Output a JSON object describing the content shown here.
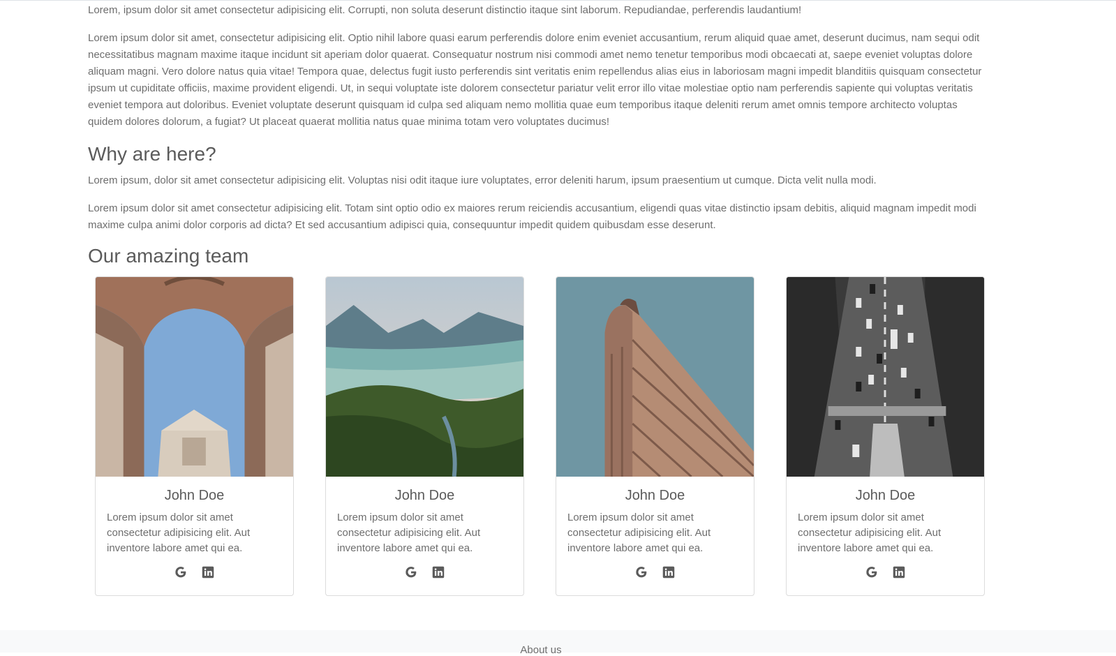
{
  "content": {
    "paragraphs_intro": [
      "Lorem, ipsum dolor sit amet consectetur adipisicing elit. Corrupti, non soluta deserunt distinctio itaque sint laborum. Repudiandae, perferendis laudantium!",
      "Lorem ipsum dolor sit amet, consectetur adipisicing elit. Optio nihil labore quasi earum perferendis dolore enim eveniet accusantium, rerum aliquid quae amet, deserunt ducimus, nam sequi odit necessitatibus magnam maxime itaque incidunt sit aperiam dolor quaerat. Consequatur nostrum nisi commodi amet nemo tenetur temporibus modi obcaecati at, saepe eveniet voluptas dolore aliquam magni. Vero dolore natus quia vitae! Tempora quae, delectus fugit iusto perferendis sint veritatis enim repellendus alias eius in laboriosam magni impedit blanditiis quisquam consectetur ipsum ut cupiditate officiis, maxime provident eligendi. Ut, in sequi voluptate iste dolorem consectetur pariatur velit error illo vitae molestiae optio nam perferendis sapiente qui voluptas veritatis eveniet tempora aut doloribus. Eveniet voluptate deserunt quisquam id culpa sed aliquam nemo mollitia quae eum temporibus itaque deleniti rerum amet omnis tempore architecto voluptas quidem dolores dolorum, a fugiat? Ut placeat quaerat mollitia natus quae minima totam vero voluptates ducimus!"
    ],
    "why_heading": "Why are here?",
    "paragraphs_why": [
      "Lorem ipsum, dolor sit amet consectetur adipisicing elit. Voluptas nisi odit itaque iure voluptates, error deleniti harum, ipsum praesentium ut cumque. Dicta velit nulla modi.",
      "Lorem ipsum dolor sit amet consectetur adipisicing elit. Totam sint optio odio ex maiores rerum reiciendis accusantium, eligendi quas vitae distinctio ipsam debitis, aliquid magnam impedit modi maxime culpa animi dolor corporis ad dicta? Et sed accusantium adipisci quia, consequuntur impedit quidem quibusdam esse deserunt."
    ],
    "team_heading": "Our amazing team"
  },
  "team": [
    {
      "name": "John Doe",
      "desc": "Lorem ipsum dolor sit amet consectetur adipisicing elit. Aut inventore labore amet qui ea.",
      "photo": "building-courtyard-sky"
    },
    {
      "name": "John Doe",
      "desc": "Lorem ipsum dolor sit amet consectetur adipisicing elit. Aut inventore labore amet qui ea.",
      "photo": "mountain-lake-forest"
    },
    {
      "name": "John Doe",
      "desc": "Lorem ipsum dolor sit amet consectetur adipisicing elit. Aut inventore labore amet qui ea.",
      "photo": "flatiron-building"
    },
    {
      "name": "John Doe",
      "desc": "Lorem ipsum dolor sit amet consectetur adipisicing elit. Aut inventore labore amet qui ea.",
      "photo": "aerial-traffic-road"
    }
  ],
  "icons": {
    "social_1": "google-icon",
    "social_2": "linkedin-icon"
  },
  "footer": {
    "link": "About us"
  },
  "colors": {
    "text": "#6e6e6e",
    "heading": "#5b5b5b",
    "footer_bg": "#f8f9fa"
  }
}
